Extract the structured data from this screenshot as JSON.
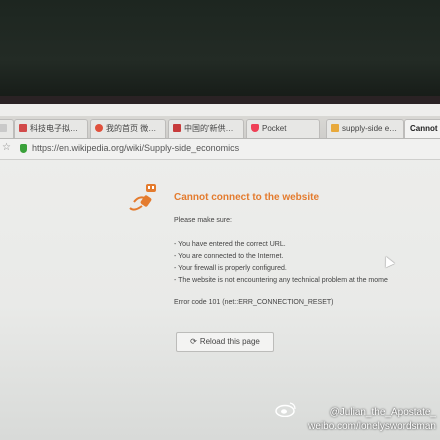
{
  "tabs": [
    {
      "label": "",
      "active": false
    },
    {
      "label": "科技电子拟…",
      "active": false
    },
    {
      "label": "我的首页 微…",
      "active": false
    },
    {
      "label": "中国的'新供…",
      "active": false
    },
    {
      "label": "Pocket",
      "active": false
    },
    {
      "label": "supply-side e…",
      "active": false
    },
    {
      "label": "Cannot",
      "active": true
    }
  ],
  "address_bar": {
    "url": "https://en.wikipedia.org/wiki/Supply-side_economics"
  },
  "error": {
    "title": "Cannot connect to the website",
    "intro": "Please make sure:",
    "items": [
      "- You have entered the correct URL.",
      "- You are connected to the Internet.",
      "- Your firewall is properly configured.",
      "- The website is not encountering any technical problem at the mome"
    ],
    "code": "Error code 101 (net::ERR_CONNECTION_RESET)",
    "reload_label": "Reload this page"
  },
  "watermark": {
    "handle": "@Julian_the_Apostate_",
    "site": "weibo.com/lonelyswordsman"
  },
  "colors": {
    "accent": "#e47b2e",
    "shield": "#3aa13a"
  }
}
